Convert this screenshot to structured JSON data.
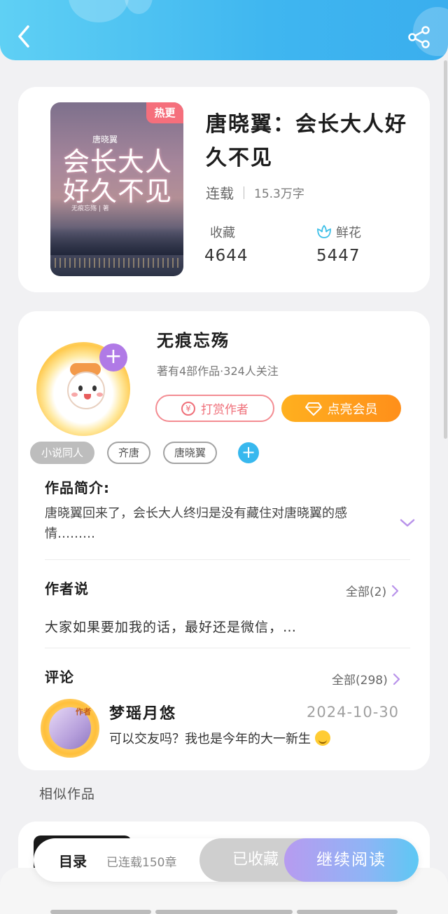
{
  "header": {
    "back_icon": "chevron-left-icon",
    "share_icon": "share-icon"
  },
  "book": {
    "cover_title": "会长大人好久不见",
    "cover_subtitle": "唐晓翼",
    "cover_author": "无痕忘殇 | 著",
    "badge": "热更",
    "title": "唐晓翼：会长大人好久不见",
    "status": "连载",
    "word_count": "15.3万字",
    "favorites_label": "收藏",
    "favorites_value": "4644",
    "flowers_label": "鲜花",
    "flowers_value": "5447",
    "flower_icon": "flower-icon"
  },
  "author": {
    "name": "无痕忘殇",
    "info": "著有4部作品·324人关注",
    "reward_label": "打赏作者",
    "vip_label": "点亮会员",
    "follow_icon": "plus-icon"
  },
  "tags": [
    "小说同人",
    "齐唐",
    "唐晓翼"
  ],
  "intro": {
    "title": "作品简介:",
    "text": "唐晓翼回来了，会长大人终归是没有藏住对唐晓翼的感情………"
  },
  "author_says": {
    "title": "作者说",
    "more": "全部(2)",
    "text": "大家如果要加我的话，最好还是微信，…"
  },
  "comments": {
    "title": "评论",
    "more": "全部(298)",
    "items": [
      {
        "name": "梦瑶月悠",
        "badge": "作者",
        "date": "2024-10-30",
        "text": "可以交友吗？我也是今年的大一新生"
      }
    ]
  },
  "similar": {
    "title": "相似作品"
  },
  "bottom_bar": {
    "toc_label": "目录",
    "toc_count": "已连载150章",
    "collected_label": "已收藏",
    "read_label": "继续阅读"
  },
  "colors": {
    "accent_blue": "#3fb6f0",
    "vip_orange": "#ff9a1c",
    "reward_pink": "#ef6f79",
    "purple": "#b07ae6"
  }
}
